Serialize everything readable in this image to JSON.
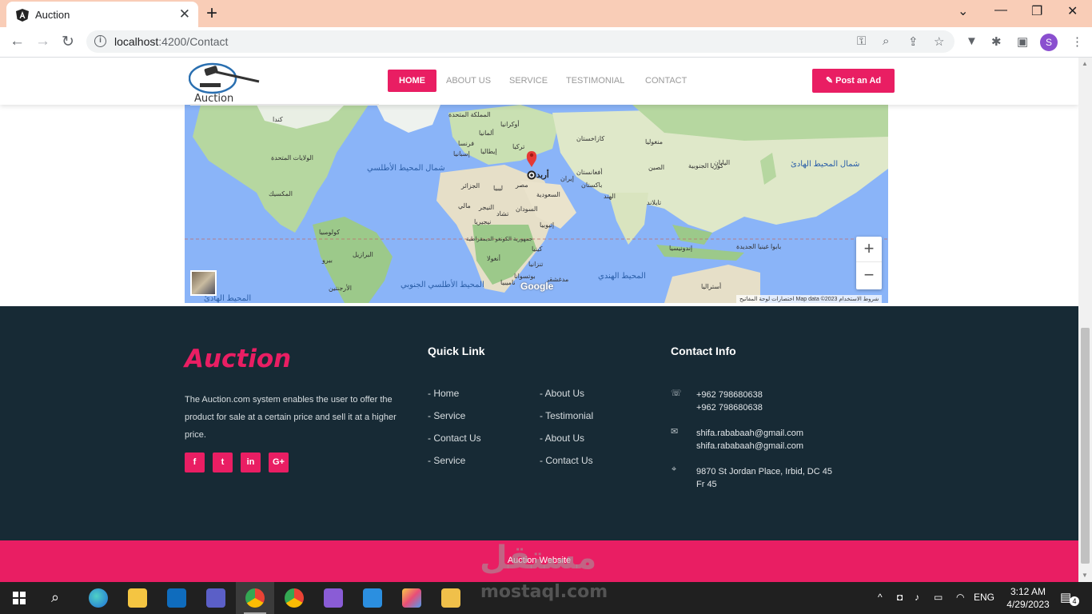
{
  "browser": {
    "tab_title": "Auction",
    "url_host": "localhost",
    "url_path": ":4200/Contact",
    "profile_initial": "S"
  },
  "site": {
    "logo_text": "Auction",
    "nav": [
      {
        "label": "HOME",
        "active": true
      },
      {
        "label": "ABOUT US",
        "active": false
      },
      {
        "label": "SERVICE",
        "active": false
      },
      {
        "label": "TESTIMONIAL",
        "active": false
      },
      {
        "label": "CONTACT",
        "active": false
      }
    ],
    "post_ad_label": "Post an Ad",
    "accent_color": "#e91e63"
  },
  "map": {
    "pin_label": "أربد",
    "google": "Google",
    "attribution": "اختصارات لوحة المفاتيح    Map data ©2023    شروط الاستخدام",
    "zoom_in": "+",
    "zoom_out": "−",
    "labels": [
      {
        "text": "كندا"
      },
      {
        "text": "الولايات المتحدة"
      },
      {
        "text": "المكسيك"
      },
      {
        "text": "كولومبيا"
      },
      {
        "text": "البرازيل"
      },
      {
        "text": "بيرو"
      },
      {
        "text": "الأرجنتين"
      },
      {
        "text": "المملكة المتحدة"
      },
      {
        "text": "فرنسا"
      },
      {
        "text": "إسبانيا"
      },
      {
        "text": "ألمانيا"
      },
      {
        "text": "إيطاليا"
      },
      {
        "text": "أوكرانيا"
      },
      {
        "text": "تركيا"
      },
      {
        "text": "الجزائر"
      },
      {
        "text": "ليبيا"
      },
      {
        "text": "مصر"
      },
      {
        "text": "مالي"
      },
      {
        "text": "النيجر"
      },
      {
        "text": "تشاد"
      },
      {
        "text": "السودان"
      },
      {
        "text": "نيجيريا"
      },
      {
        "text": "السعودية"
      },
      {
        "text": "إيران"
      },
      {
        "text": "كازاخستان"
      },
      {
        "text": "منغوليا"
      },
      {
        "text": "الصين"
      },
      {
        "text": "الهند"
      },
      {
        "text": "باكستان"
      },
      {
        "text": "أفغانستان"
      },
      {
        "text": "اليابان"
      },
      {
        "text": "كوريا الجنوبية"
      },
      {
        "text": "تايلاند"
      },
      {
        "text": "إندونيسيا"
      },
      {
        "text": "بابوا غينيا الجديدة"
      },
      {
        "text": "أستراليا"
      },
      {
        "text": "كينيا"
      },
      {
        "text": "تنزانيا"
      },
      {
        "text": "أنغولا"
      },
      {
        "text": "ناميبيا"
      },
      {
        "text": "بوتسوانا"
      },
      {
        "text": "مدغشقر"
      },
      {
        "text": "جمهورية الكونغو الديمقراطية"
      },
      {
        "text": "إثيوبيا"
      }
    ],
    "oceans": [
      {
        "text": "شمال المحيط الأطلسي"
      },
      {
        "text": "شمال المحيط الهادئ"
      },
      {
        "text": "المحيط الهندي"
      },
      {
        "text": "المحيط الأطلسي الجنوبي"
      },
      {
        "text": "المحيط الهادئ"
      }
    ]
  },
  "footer": {
    "brand": "Auction",
    "about": "The Auction.com system enables the user to offer the product for sale at a certain price and sell it at a higher price.",
    "social": [
      "f",
      "t",
      "in",
      "G+"
    ],
    "quick_title": "Quick Link",
    "quick_links_left": [
      "- Home",
      "- Service",
      "- Contact Us",
      "- Service"
    ],
    "quick_links_right": [
      "- About Us",
      "- Testimonial",
      "- About Us",
      "- Contact Us"
    ],
    "contact_title": "Contact Info",
    "phone_1": "+962 798680638",
    "phone_2": "+962 798680638",
    "email_1": "shifa.rababaah@gmail.com",
    "email_2": "shifa.rababaah@gmail.com",
    "address_1": "9870 St Jordan Place, Irbid, DC 45",
    "address_2": "Fr 45",
    "copyright": "Auction Website"
  },
  "watermark": {
    "arabic": "مستقل",
    "latin": "mostaql.com"
  },
  "taskbar": {
    "language": "ENG",
    "time": "3:12 AM",
    "date": "4/29/2023",
    "notifications": "4"
  }
}
